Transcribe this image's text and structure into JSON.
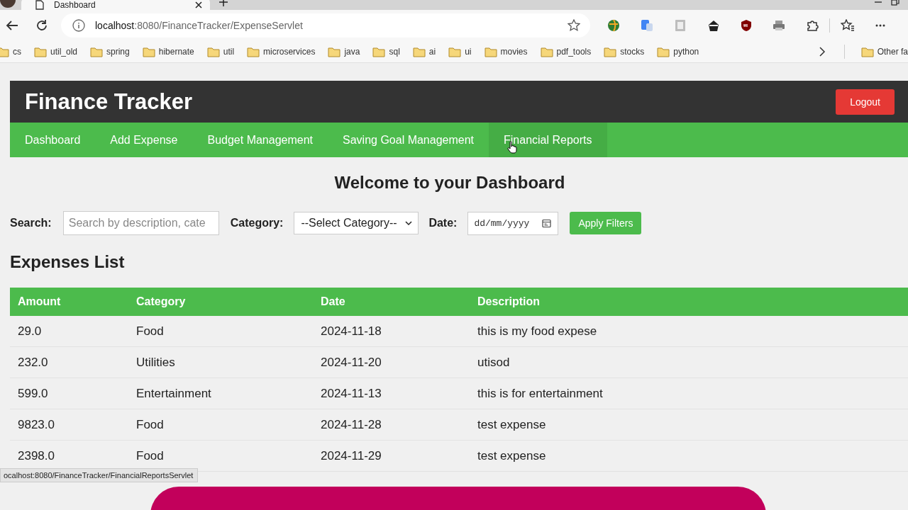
{
  "browser": {
    "tab": {
      "title": "Dashboard"
    },
    "address": {
      "host": "localhost",
      "path": ":8080/FinanceTracker/ExpenseServlet"
    },
    "bookmarks": [
      "cs",
      "util_old",
      "spring",
      "hibernate",
      "util",
      "microservices",
      "java",
      "sql",
      "ai",
      "ui",
      "movies",
      "pdf_tools",
      "stocks",
      "python"
    ],
    "other_bookmarks": "Other fa",
    "status_url": "ocalhost:8080/FinanceTracker/FinancialReportsServlet"
  },
  "app": {
    "title": "Finance Tracker",
    "logout": "Logout",
    "nav": [
      {
        "label": "Dashboard",
        "hovered": false
      },
      {
        "label": "Add Expense",
        "hovered": false
      },
      {
        "label": "Budget Management",
        "hovered": false
      },
      {
        "label": "Saving Goal Management",
        "hovered": false
      },
      {
        "label": "Financial Reports",
        "hovered": true
      }
    ],
    "heading": "Welcome to your Dashboard",
    "filters": {
      "search_label": "Search:",
      "search_placeholder": "Search by description, cate",
      "category_label": "Category:",
      "category_value": "--Select Category--",
      "date_label": "Date:",
      "date_placeholder": "dd/mm/yyyy",
      "apply": "Apply Filters"
    },
    "list_title": "Expenses List",
    "table": {
      "columns": [
        "Amount",
        "Category",
        "Date",
        "Description"
      ],
      "rows": [
        [
          "29.0",
          "Food",
          "2024-11-18",
          "this is my food expese"
        ],
        [
          "232.0",
          "Utilities",
          "2024-11-20",
          "utisod"
        ],
        [
          "599.0",
          "Entertainment",
          "2024-11-13",
          "this is for entertainment"
        ],
        [
          "9823.0",
          "Food",
          "2024-11-28",
          "test expense"
        ],
        [
          "2398.0",
          "Food",
          "2024-11-29",
          "test expense"
        ]
      ]
    }
  }
}
